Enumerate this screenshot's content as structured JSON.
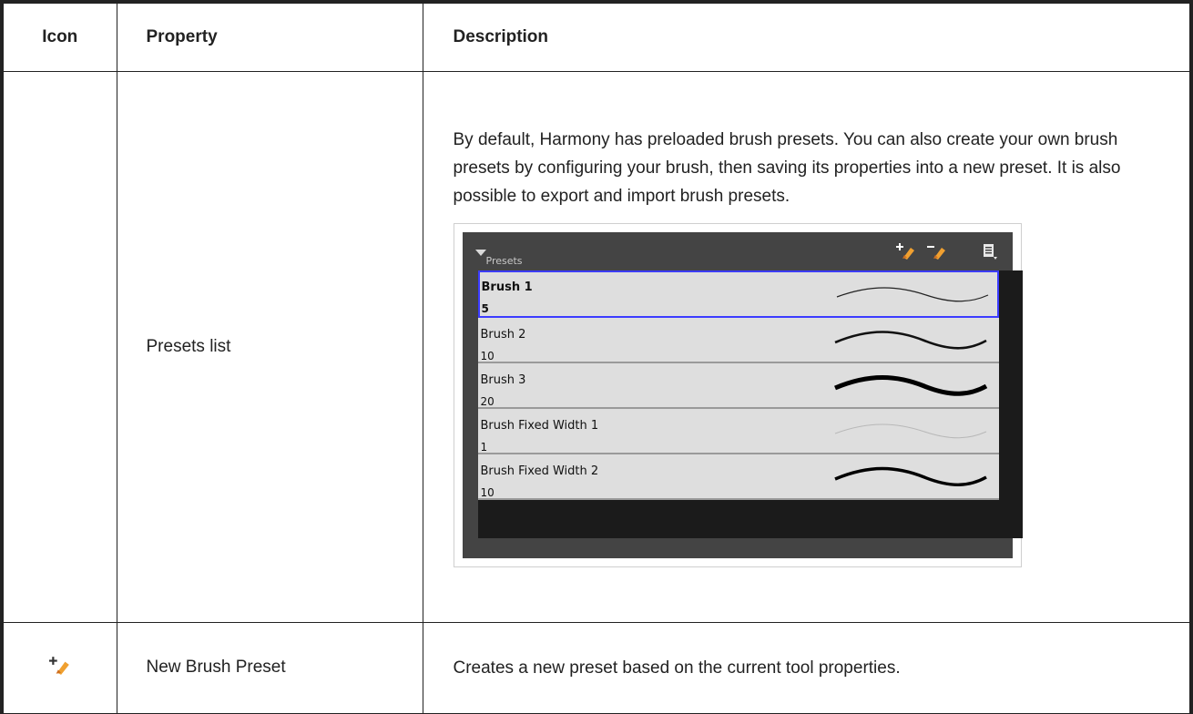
{
  "header": {
    "icon": "Icon",
    "property": "Property",
    "description": "Description"
  },
  "rows": [
    {
      "property": "Presets list",
      "description": "By default, Harmony has preloaded brush presets. You can also create your own brush presets by configuring your brush, then saving its properties into a new preset. It is also possible to export and import brush presets.",
      "panel": {
        "title": "Presets",
        "toolbar_icons": [
          "new-brush-preset-icon",
          "delete-brush-preset-icon",
          "presets-menu-icon"
        ],
        "presets": [
          {
            "name": "Brush 1",
            "size": "5",
            "selected": true
          },
          {
            "name": "Brush 2",
            "size": "10",
            "selected": false
          },
          {
            "name": "Brush 3",
            "size": "20",
            "selected": false
          },
          {
            "name": "Brush Fixed Width 1",
            "size": "1",
            "selected": false
          },
          {
            "name": "Brush Fixed Width 2",
            "size": "10",
            "selected": false
          }
        ],
        "colors": {
          "selection_border": "#3c3cff",
          "panel_bg": "#444444",
          "item_bg": "#dedede"
        }
      }
    },
    {
      "icon": "new-brush-preset-icon",
      "property": "New Brush Preset",
      "description": "Creates a new preset based on the current tool properties."
    }
  ]
}
